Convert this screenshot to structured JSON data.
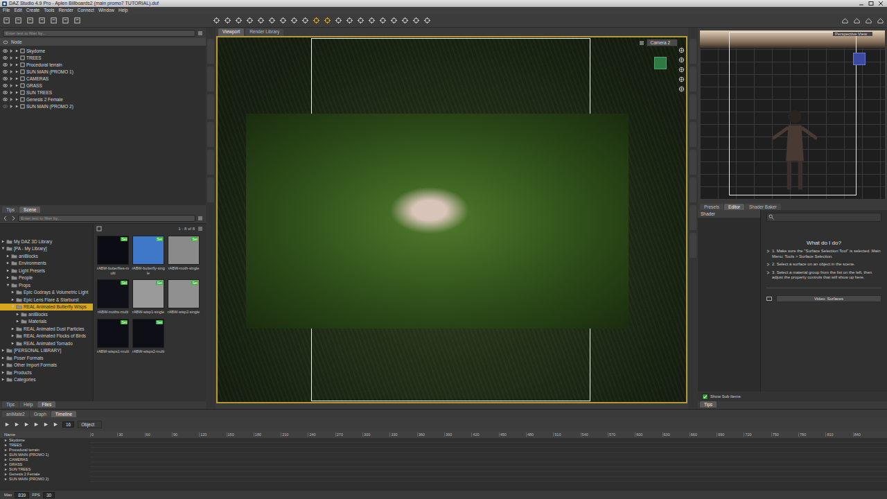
{
  "window": {
    "title": "DAZ Studio 4.9 Pro - Aplen Billboards2 (main promo7 TUTORIAL).duf"
  },
  "menu": [
    "File",
    "Edit",
    "Create",
    "Tools",
    "Render",
    "Connect",
    "Window",
    "Help"
  ],
  "scene": {
    "search_placeholder": "Enter text to filter by...",
    "column": "Node",
    "nodes": [
      {
        "label": "Skydome",
        "visible": true
      },
      {
        "label": "TREES",
        "visible": true
      },
      {
        "label": "Procedural terrain",
        "visible": true
      },
      {
        "label": "SUN MAIN (PROMO 1)",
        "visible": true
      },
      {
        "label": "CAMERAS",
        "visible": true
      },
      {
        "label": "GRASS",
        "visible": true
      },
      {
        "label": "SUN TREES",
        "visible": true
      },
      {
        "label": "Genesis 2 Female",
        "visible": true
      },
      {
        "label": "SUN MAIN (PROMO 2)",
        "visible": false
      }
    ]
  },
  "left_tabs": [
    {
      "label": "Tips",
      "selected": false
    },
    {
      "label": "Scene",
      "selected": true
    }
  ],
  "content_library": {
    "search_placeholder": "Enter text to filter by...",
    "count": "1 - 8 of 8",
    "tree": [
      {
        "label": "My DAZ 3D Library",
        "depth": 0,
        "expanded": false,
        "selected": false
      },
      {
        "label": "[PA - My Library]",
        "depth": 0,
        "expanded": true,
        "selected": false
      },
      {
        "label": "aniBlocks",
        "depth": 1,
        "expanded": false,
        "selected": false
      },
      {
        "label": "Environments",
        "depth": 1,
        "expanded": false,
        "selected": false
      },
      {
        "label": "Light Presets",
        "depth": 1,
        "expanded": false,
        "selected": false
      },
      {
        "label": "People",
        "depth": 1,
        "expanded": false,
        "selected": false
      },
      {
        "label": "Props",
        "depth": 1,
        "expanded": true,
        "selected": false
      },
      {
        "label": "Epic Godrays & Volumetric Light",
        "depth": 2,
        "expanded": false,
        "selected": false
      },
      {
        "label": "Epic Lens Flare & Starburst",
        "depth": 2,
        "expanded": false,
        "selected": false
      },
      {
        "label": "REAL Animated Butterfly Wisps",
        "depth": 2,
        "expanded": true,
        "selected": true
      },
      {
        "label": "aniBlocks",
        "depth": 3,
        "expanded": false,
        "selected": false
      },
      {
        "label": "Materials",
        "depth": 3,
        "expanded": false,
        "selected": false
      },
      {
        "label": "REAL Animated Dust Particles",
        "depth": 2,
        "expanded": false,
        "selected": false
      },
      {
        "label": "REAL Animated Flocks of Birds",
        "depth": 2,
        "expanded": false,
        "selected": false
      },
      {
        "label": "REAL Animated Tornado",
        "depth": 2,
        "expanded": false,
        "selected": false
      },
      {
        "label": "[PERSONAL LIBRARY]",
        "depth": 0,
        "expanded": false,
        "selected": false
      },
      {
        "label": "Poser Formats",
        "depth": 0,
        "expanded": false,
        "selected": false
      },
      {
        "label": "Other Import Formats",
        "depth": 0,
        "expanded": false,
        "selected": false
      },
      {
        "label": "Products",
        "depth": 0,
        "expanded": false,
        "selected": false
      },
      {
        "label": "Categories",
        "depth": 0,
        "expanded": false,
        "selected": false
      }
    ],
    "items": [
      {
        "label": "rABW-butterflies-multi",
        "badge": "Set",
        "color": "#0c0c14"
      },
      {
        "label": "rABW-butterfly-single",
        "badge": "Set",
        "color": "#3f78c8"
      },
      {
        "label": "rABW-moth-single",
        "badge": "Set",
        "color": "#8a8a8a"
      },
      {
        "label": "rABW-moths-multi",
        "badge": "Set",
        "color": "#101018"
      },
      {
        "label": "rABW-wisp1-single",
        "badge": "Set",
        "color": "#9a9a9a"
      },
      {
        "label": "rABW-wisp2-single",
        "badge": "Set",
        "color": "#909090"
      },
      {
        "label": "rABW-wisps1-multi",
        "badge": "Set",
        "color": "#0e0e16"
      },
      {
        "label": "rABW-wisps2-multi",
        "badge": "Set",
        "color": "#0e0e16"
      }
    ],
    "bottom_tabs": [
      {
        "label": "Tips",
        "selected": false
      },
      {
        "label": "Help",
        "selected": false
      },
      {
        "label": "Files",
        "selected": true
      }
    ]
  },
  "viewport": {
    "tabs": [
      {
        "label": "Viewport",
        "selected": true
      },
      {
        "label": "Render Library",
        "selected": false
      }
    ],
    "camera": "Camera 2"
  },
  "aux_viewport": {
    "camera": "Perspective View"
  },
  "surfaces": {
    "tabs": [
      {
        "label": "Presets",
        "selected": false
      },
      {
        "label": "Editor",
        "selected": true
      },
      {
        "label": "Shader Baker",
        "selected": false
      }
    ],
    "list_header": "Shader",
    "help_title": "What do I do?",
    "steps": [
      "1. Make sure the \"Surface Selection Tool\" is selected. Main Menu: Tools > Surface Selection.",
      "2. Select a surface on an object in the scene.",
      "3. Select a material group from the list on the left, then adjust the property controls that will show up here."
    ],
    "button": "Video: Surfaces",
    "show_sub_items": {
      "label": "Show Sub Items",
      "checked": true
    },
    "bottom_tabs": [
      {
        "label": "Tips",
        "selected": true
      }
    ]
  },
  "timeline": {
    "tabs": [
      {
        "label": "aniMate2",
        "selected": false
      },
      {
        "label": "Graph",
        "selected": false
      },
      {
        "label": "Timeline",
        "selected": true
      }
    ],
    "frame": "16",
    "mode": "Object",
    "column": "Name",
    "ticks": [
      "0",
      "30",
      "60",
      "90",
      "120",
      "150",
      "180",
      "210",
      "240",
      "270",
      "300",
      "330",
      "360",
      "390",
      "420",
      "450",
      "480",
      "510",
      "540",
      "570",
      "600",
      "630",
      "660",
      "690",
      "720",
      "750",
      "780",
      "810",
      "840"
    ],
    "tracks": [
      "Skydome",
      "TREES",
      "Procedural terrain",
      "SUN MAIN (PROMO 1)",
      "CAMERAS",
      "GRASS",
      "SUN TREES",
      "Genesis 2 Female",
      "SUN MAIN (PROMO 2)"
    ],
    "footer": {
      "max_label": "Max",
      "max": "839",
      "fps_label": "FPS",
      "fps": "30"
    }
  }
}
